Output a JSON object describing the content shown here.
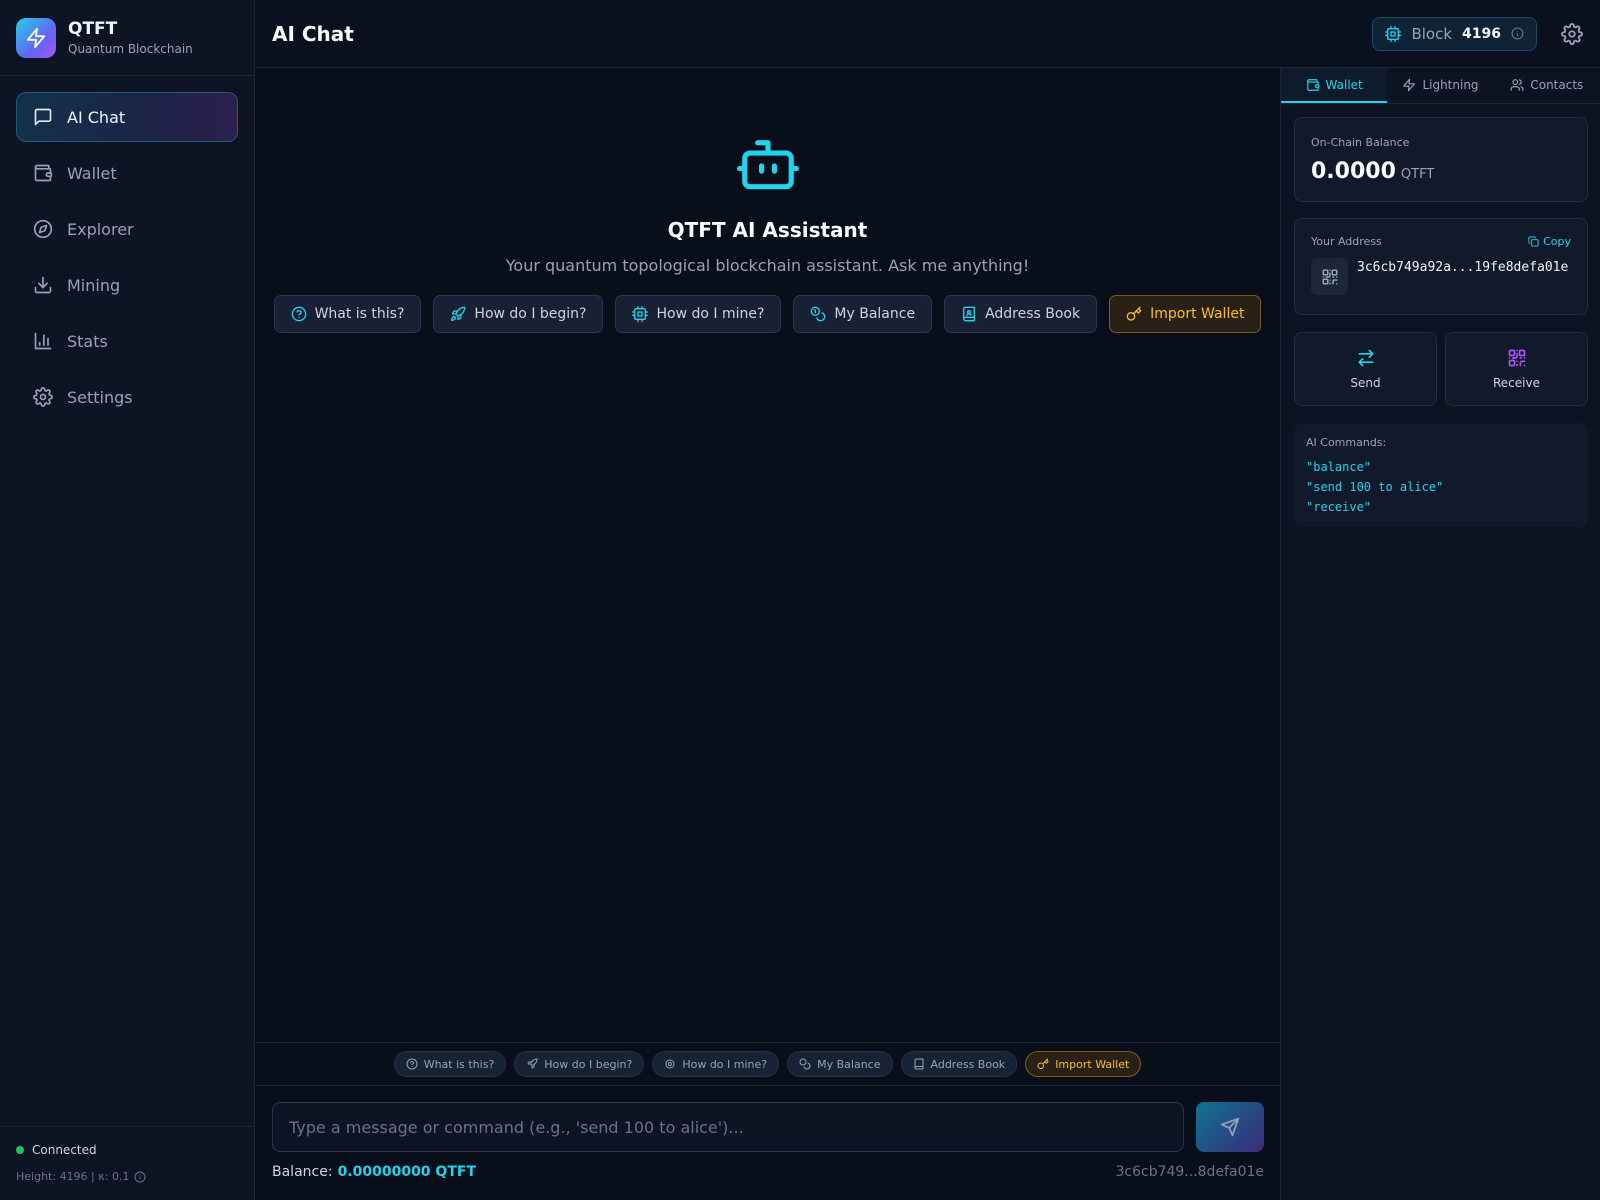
{
  "colors": {
    "accent": "#22d3ee",
    "purple": "#a855f7",
    "warning": "#fbbf24",
    "success": "#22c55e",
    "background": "#0a0f1c"
  },
  "brand": {
    "name": "QTFT",
    "subtitle": "Quantum Blockchain",
    "icon": "lightning-icon"
  },
  "sidebar": {
    "items": [
      {
        "label": "AI Chat",
        "icon": "message-square-icon",
        "active": true
      },
      {
        "label": "Wallet",
        "icon": "wallet-icon"
      },
      {
        "label": "Explorer",
        "icon": "compass-icon"
      },
      {
        "label": "Mining",
        "icon": "download-icon"
      },
      {
        "label": "Stats",
        "icon": "bar-chart-icon"
      },
      {
        "label": "Settings",
        "icon": "gear-icon"
      }
    ],
    "footer": {
      "status": "Connected",
      "height_text": "Height: 4196 | κ: 0.1"
    }
  },
  "header": {
    "title": "AI Chat",
    "block_label": "Block",
    "block_number": "4196"
  },
  "hero": {
    "title": "QTFT AI Assistant",
    "subtitle": "Your quantum topological blockchain assistant. Ask me anything!"
  },
  "quick_actions": [
    {
      "label": "What is this?",
      "icon": "help-circle-icon"
    },
    {
      "label": "How do I begin?",
      "icon": "rocket-icon"
    },
    {
      "label": "How do I mine?",
      "icon": "cpu-icon"
    },
    {
      "label": "My Balance",
      "icon": "coins-icon"
    },
    {
      "label": "Address Book",
      "icon": "book-icon"
    },
    {
      "label": "Import Wallet",
      "icon": "key-icon",
      "style": "warning"
    }
  ],
  "composer": {
    "placeholder": "Type a message or command (e.g., 'send 100 to alice')...",
    "value": "",
    "balance_label": "Balance:",
    "balance_value": "0.00000000 QTFT",
    "address_short": "3c6cb749...8defa01e"
  },
  "right_panel": {
    "tabs": [
      {
        "label": "Wallet",
        "icon": "wallet-icon",
        "active": true
      },
      {
        "label": "Lightning",
        "icon": "lightning-icon"
      },
      {
        "label": "Contacts",
        "icon": "users-icon"
      }
    ],
    "balance": {
      "label": "On-Chain Balance",
      "amount": "0.0000",
      "unit": "QTFT"
    },
    "address": {
      "label": "Your Address",
      "copy_label": "Copy",
      "value": "3c6cb749a92a...19fe8defa01e"
    },
    "actions": {
      "send": "Send",
      "receive": "Receive"
    },
    "commands": {
      "title": "AI Commands:",
      "items": [
        "\"balance\"",
        "\"send 100 to alice\"",
        "\"receive\""
      ]
    }
  }
}
